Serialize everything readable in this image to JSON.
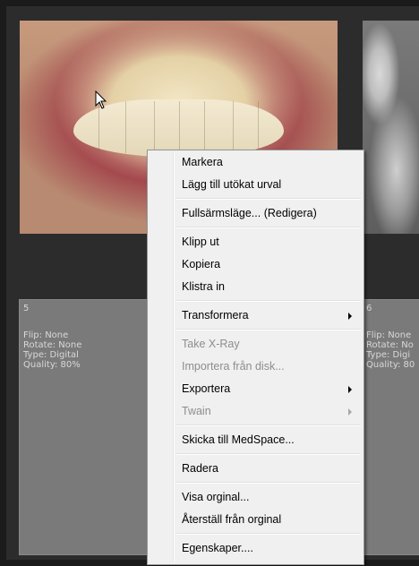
{
  "thumbnails": [
    {
      "number": "5",
      "flip": "Flip: None",
      "rotate": "Rotate: None",
      "type": "Type: Digital",
      "quality": "Quality: 80%"
    },
    {
      "number": "6",
      "flip": "Flip: None",
      "rotate": "Rotate: No",
      "type": "Type: Digi",
      "quality": "Quality: 80"
    }
  ],
  "context_menu": {
    "items": [
      {
        "label": "Markera",
        "enabled": true
      },
      {
        "label": "Lägg till utökat urval",
        "enabled": true
      },
      {
        "label": "Fullsärmsläge... (Redigera)",
        "enabled": true
      },
      {
        "label": "Klipp ut",
        "enabled": true
      },
      {
        "label": "Kopiera",
        "enabled": true
      },
      {
        "label": "Klistra in",
        "enabled": true
      },
      {
        "label": "Transformera",
        "enabled": true,
        "submenu": true
      },
      {
        "label": "Take X-Ray",
        "enabled": false
      },
      {
        "label": "Importera från disk...",
        "enabled": false
      },
      {
        "label": "Exportera",
        "enabled": true,
        "submenu": true
      },
      {
        "label": "Twain",
        "enabled": false,
        "submenu": true
      },
      {
        "label": "Skicka till MedSpace...",
        "enabled": true
      },
      {
        "label": "Radera",
        "enabled": true
      },
      {
        "label": "Visa orginal...",
        "enabled": true
      },
      {
        "label": "Återställ från orginal",
        "enabled": true
      },
      {
        "label": "Egenskaper....",
        "enabled": true
      }
    ]
  },
  "colors": {
    "background": "#2c2c2c",
    "card": "#7a7a7a",
    "menu_bg": "#f0f0f0",
    "disabled_text": "#8d8d8d"
  },
  "icons": [
    "mouse-cursor-icon",
    "submenu-arrow-icon"
  ]
}
